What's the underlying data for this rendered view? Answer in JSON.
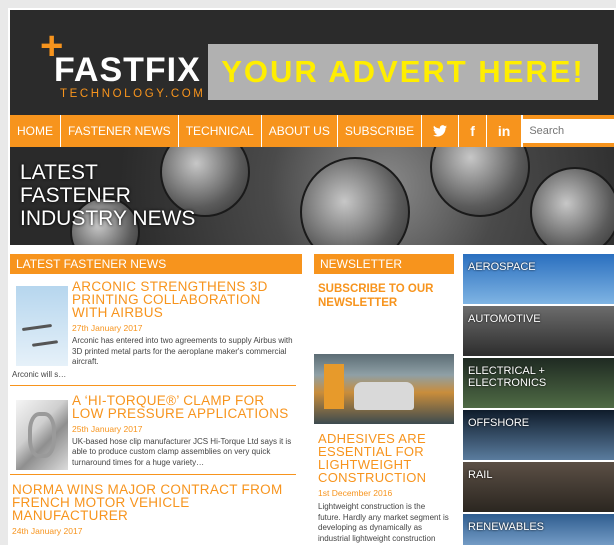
{
  "brand": {
    "logo_main": "FASTFIX",
    "logo_plus": "+",
    "logo_sub": "TECHNOLOGY.COM",
    "accent": "#f7941d"
  },
  "advert": {
    "text": "YOUR ADVERT HERE!",
    "color": "#ffee00"
  },
  "nav": {
    "items": [
      "HOME",
      "FASTENER NEWS",
      "TECHNICAL",
      "ABOUT US",
      "SUBSCRIBE"
    ],
    "social": [
      {
        "icon": "twitter-icon",
        "glyph": "🐦"
      },
      {
        "icon": "facebook-icon",
        "glyph": "f"
      },
      {
        "icon": "linkedin-icon",
        "glyph": "in"
      }
    ],
    "search_placeholder": "Search"
  },
  "hero": {
    "title": "LATEST FASTENER INDUSTRY NEWS"
  },
  "news": {
    "heading": "LATEST FASTENER NEWS",
    "items": [
      {
        "title": "ARCONIC STRENGTHENS 3D PRINTING COLLABORATION WITH AIRBUS",
        "date": "27th January 2017",
        "text": "Arconic has entered into two agreements to supply Airbus with 3D printed metal parts for the aeroplane maker's commercial aircraft.",
        "cont": "Arconic will s…"
      },
      {
        "title": "A ‘HI-TORQUE®’ CLAMP FOR LOW PRESSURE APPLICATIONS",
        "date": "25th January 2017",
        "text": "UK-based hose clip manufacturer JCS Hi-Torque Ltd says it is able to produce custom clamp assemblies on very quick turnaround times for a huge variety…"
      },
      {
        "title": "NORMA WINS MAJOR CONTRACT FROM FRENCH MOTOR VEHICLE MANUFACTURER",
        "date": "24th January 2017"
      }
    ]
  },
  "newsletter": {
    "heading": "NEWSLETTER",
    "subscribe_text": "SUBSCRIBE TO OUR NEWSLETTER",
    "feature_title": "ADHESIVES ARE ESSENTIAL FOR LIGHTWEIGHT CONSTRUCTION",
    "feature_date": "1st December 2016",
    "feature_text": "Lightweight construction is the future. Hardly any market segment is developing as dynamically as industrial lightweight construction and hardly any t…"
  },
  "sectors": [
    "AEROSPACE",
    "AUTOMOTIVE",
    "ELECTRICAL + ELECTRONICS",
    "OFFSHORE",
    "RAIL",
    "RENEWABLES"
  ]
}
